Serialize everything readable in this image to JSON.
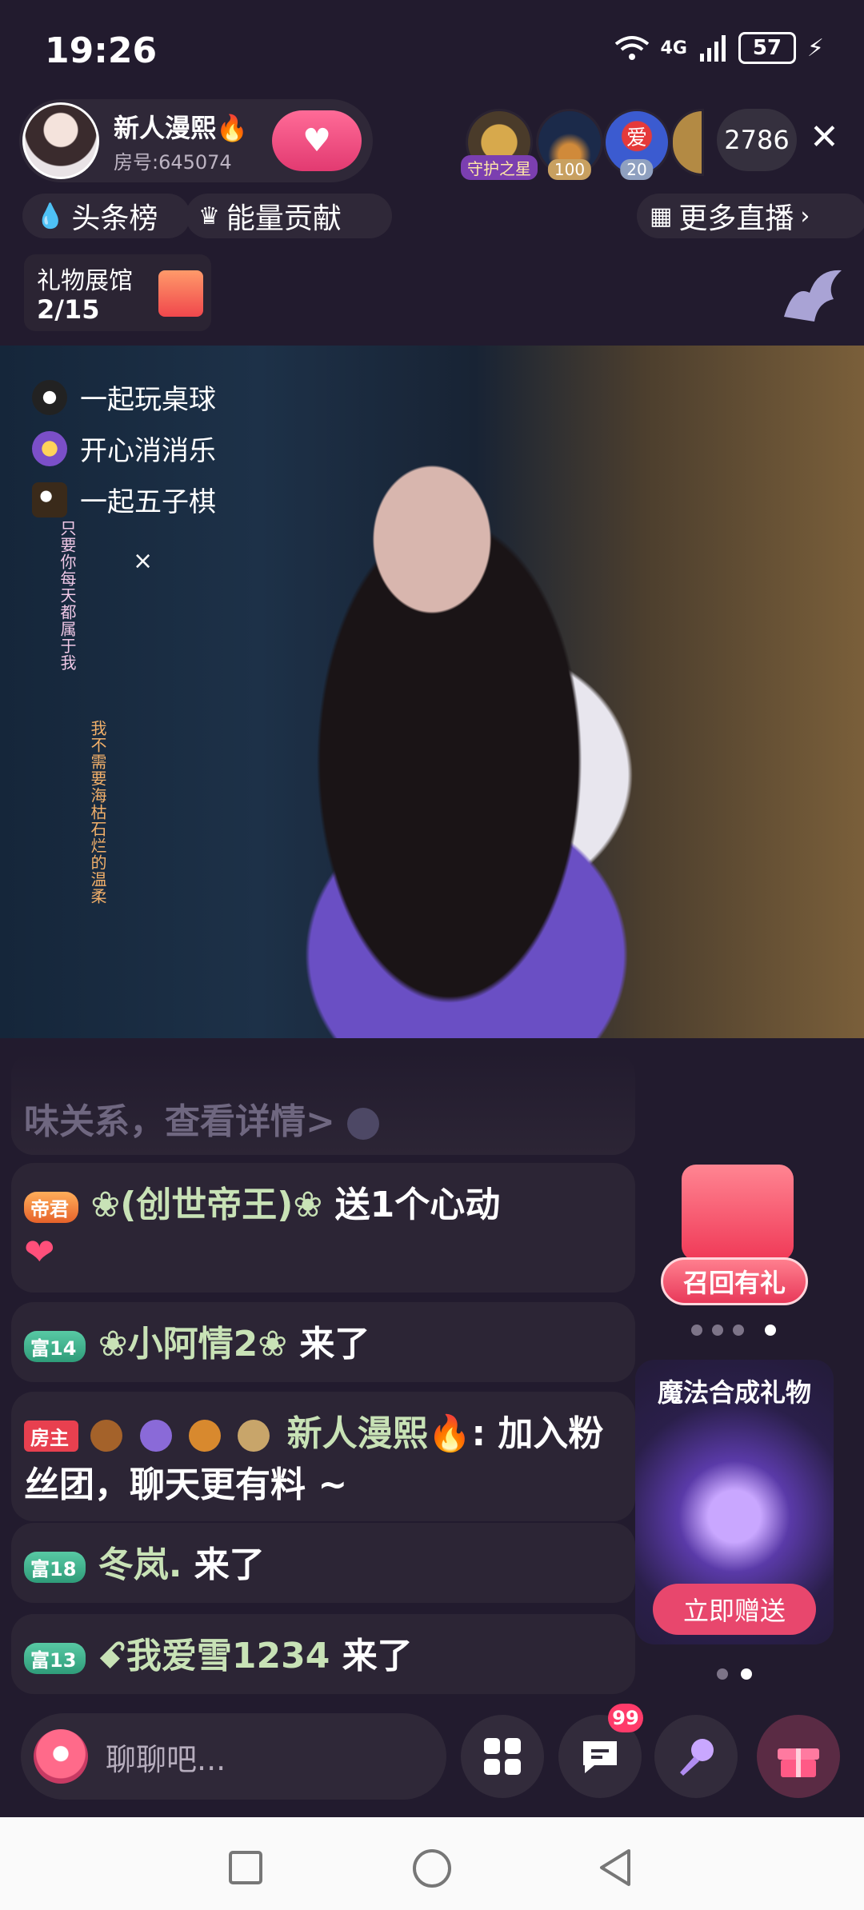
{
  "status_bar": {
    "time": "19:26",
    "network": "4G",
    "battery": "57"
  },
  "host": {
    "name": "新人漫熙🔥",
    "room": "房号:645074"
  },
  "audience": {
    "badges": [
      "守护之星",
      "100",
      "20"
    ],
    "avatar_text": "爱",
    "count": "2786"
  },
  "nav_row": {
    "headline": "头条榜",
    "energy": "能量贡献",
    "more_live": "更多直播"
  },
  "gift_hall": {
    "title": "礼物展馆",
    "progress": "2/15"
  },
  "games": [
    {
      "label": "一起玩桌球"
    },
    {
      "label": "开心消消乐"
    },
    {
      "label": "一起五子棋"
    }
  ],
  "video_overlay": {
    "vertical1": "只要你每天都属于我",
    "vertical2": "我不需要海枯石烂的温柔",
    "close": "×"
  },
  "chat": {
    "partial": "味关系，查看详情>",
    "msg1": {
      "badge": "帝君",
      "user": "❀(创世帝王)❀",
      "text": "送1个心动"
    },
    "msg2": {
      "badge": "富14",
      "user": "❀小阿情2❀",
      "text": "来了"
    },
    "msg3": {
      "badge": "房主",
      "user": "新人漫熙🔥",
      "text": ": 加入粉丝团，聊天更有料 ~"
    },
    "msg4": {
      "badge": "富18",
      "user": "冬岚.",
      "text": "来了"
    },
    "msg5": {
      "badge": "富13",
      "user": "ꗃ我爱雪1234",
      "text": "来了"
    }
  },
  "side": {
    "recall": "召回有礼",
    "magic_title": "魔法合成礼物",
    "send": "立即赠送"
  },
  "bottom": {
    "placeholder": "聊聊吧...",
    "badge_count": "99"
  }
}
